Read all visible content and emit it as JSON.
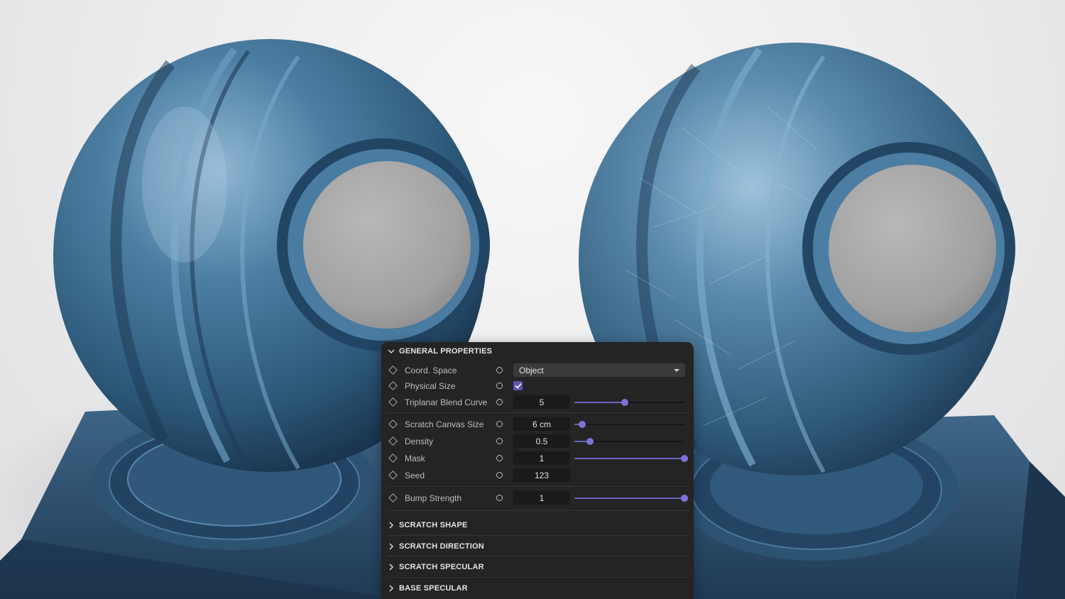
{
  "panel": {
    "general_properties": {
      "title": "GENERAL PROPERTIES",
      "rows": [
        {
          "label": "Coord. Space",
          "type": "dropdown",
          "value": "Object"
        },
        {
          "label": "Physical Size",
          "type": "checkbox",
          "checked": true
        },
        {
          "label": "Triplanar Blend Curve",
          "type": "slider",
          "value": "5",
          "slider_fraction": 0.46
        },
        {
          "label": "Scratch Canvas Size",
          "type": "slider",
          "value": "6 cm",
          "slider_fraction": 0.07
        },
        {
          "label": "Density",
          "type": "slider",
          "value": "0.5",
          "slider_fraction": 0.14
        },
        {
          "label": "Mask",
          "type": "slider",
          "value": "1",
          "slider_fraction": 1.0
        },
        {
          "label": "Seed",
          "type": "field",
          "value": "123"
        },
        {
          "label": "Bump Strength",
          "type": "slider",
          "value": "1",
          "slider_fraction": 1.0
        }
      ]
    },
    "collapsed_sections": [
      {
        "title": "SCRATCH SHAPE"
      },
      {
        "title": "SCRATCH DIRECTION"
      },
      {
        "title": "SCRATCH SPECULAR"
      },
      {
        "title": "BASE SPECULAR"
      }
    ],
    "accent_color": "#6a64c4"
  }
}
